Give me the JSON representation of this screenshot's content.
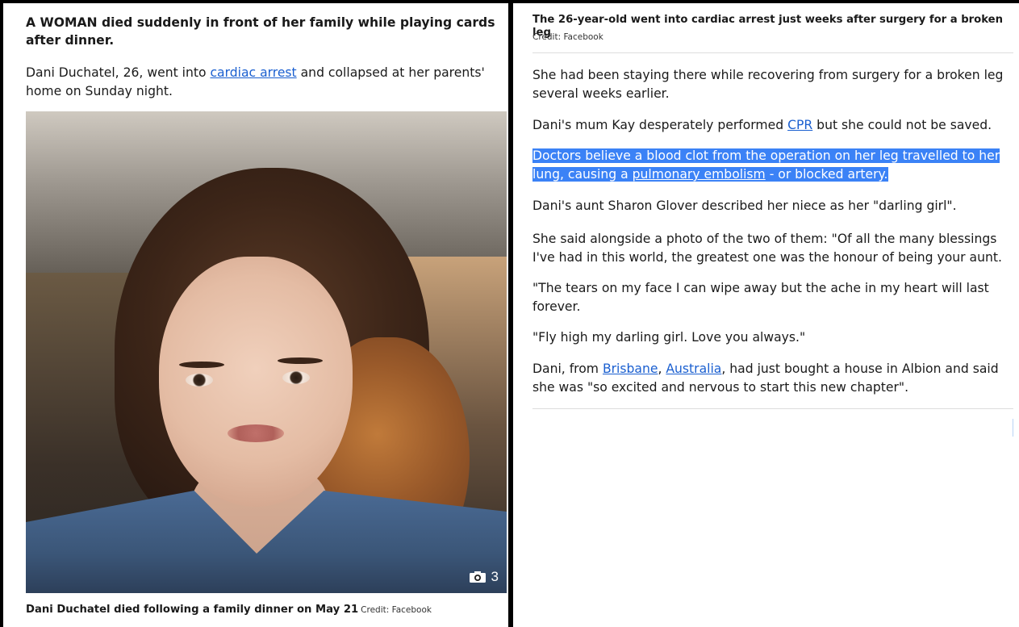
{
  "left": {
    "lede": "A WOMAN died suddenly in front of her family while playing cards after dinner.",
    "intro_before": "Dani Duchatel, 26, went into ",
    "intro_link": "cardiac arrest",
    "intro_after": " and collapsed at her parents' home on Sunday night.",
    "photo_count": "3",
    "photo_icon": "camera-icon",
    "caption": "Dani Duchatel died following a family dinner on May 21",
    "credit": "Credit: Facebook"
  },
  "right": {
    "caption": "The 26-year-old went into cardiac arrest just weeks after surgery for a broken leg",
    "credit": "Credit: Facebook",
    "p1": "She had been staying there while recovering from surgery for a broken leg several weeks earlier.",
    "p2_before": "Dani's mum Kay desperately performed ",
    "p2_link": "CPR",
    "p2_after": " but she could not be saved.",
    "p3_before": "Doctors believe a blood clot from the operation on her leg travelled to her lung, causing a ",
    "p3_link": "pulmonary embolism",
    "p3_after": " - or blocked artery.",
    "p4": "Dani's aunt Sharon Glover described her niece as her \"darling girl\".",
    "p5": "She said alongside a photo of the two of them: \"Of all the many blessings I've had in this world, the greatest one was the honour of being your aunt.",
    "p6": "\"The tears on my face I can wipe away but the ache in my heart will last forever.",
    "p7": "\"Fly high my darling girl. Love you always.\"",
    "p8_before": "Dani, from ",
    "p8_link1": "Brisbane",
    "p8_sep": ", ",
    "p8_link2": "Australia",
    "p8_after": ", had just bought a house in Albion and said she was \"so excited and nervous to start this new chapter\"."
  },
  "colors": {
    "link": "#1a5fd0",
    "highlight": "#3b82f6",
    "divider": "#000000"
  }
}
